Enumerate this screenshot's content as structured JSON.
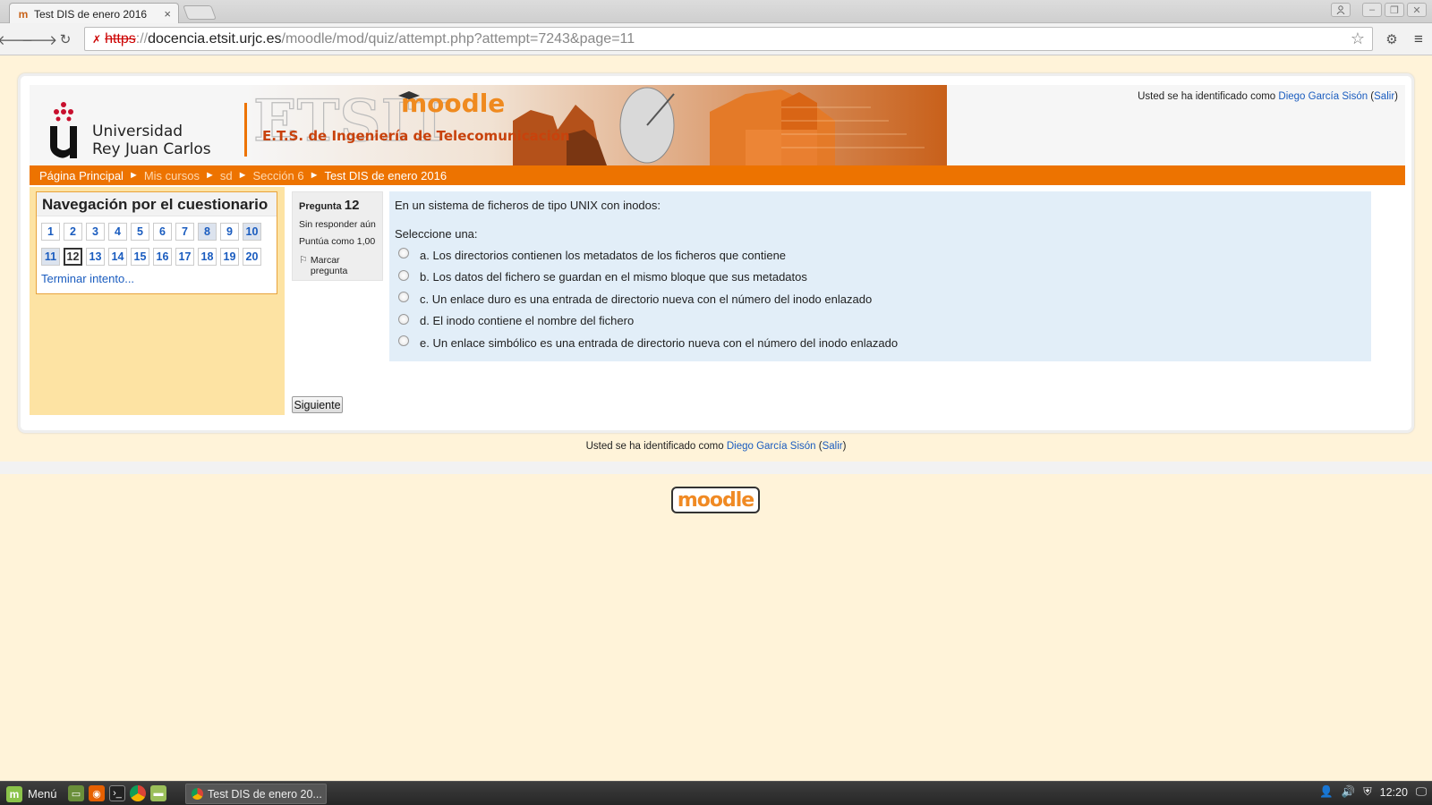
{
  "browser": {
    "tab_title": "Test DIS de enero 2016",
    "tab_close": "×",
    "url_scheme": "https",
    "url_sep": "://",
    "url_host": "docencia.etsit.urjc.es",
    "url_path": "/moodle/mod/quiz/attempt.php?attempt=7243&page=11"
  },
  "header": {
    "university_line1": "Universidad",
    "university_line2": "Rey Juan Carlos",
    "banner_etsit": "ETSIT",
    "banner_moodle": "moodle",
    "banner_school": "E.T.S. de Ingeniería de Telecomunicación",
    "login_prefix": "Usted se ha identificado como",
    "user_name": "Diego García Sisón",
    "logout": "Salir"
  },
  "breadcrumb": [
    "Página Principal",
    "Mis cursos",
    "sd",
    "Sección 6",
    "Test DIS de enero 2016"
  ],
  "quiz_nav": {
    "title": "Navegación por el cuestionario",
    "questions": [
      {
        "n": "1",
        "state": "normal"
      },
      {
        "n": "2",
        "state": "normal"
      },
      {
        "n": "3",
        "state": "normal"
      },
      {
        "n": "4",
        "state": "normal"
      },
      {
        "n": "5",
        "state": "normal"
      },
      {
        "n": "6",
        "state": "normal"
      },
      {
        "n": "7",
        "state": "normal"
      },
      {
        "n": "8",
        "state": "answered"
      },
      {
        "n": "9",
        "state": "normal"
      },
      {
        "n": "10",
        "state": "answered"
      },
      {
        "n": "11",
        "state": "answered"
      },
      {
        "n": "12",
        "state": "current"
      },
      {
        "n": "13",
        "state": "normal"
      },
      {
        "n": "14",
        "state": "normal"
      },
      {
        "n": "15",
        "state": "normal"
      },
      {
        "n": "16",
        "state": "normal"
      },
      {
        "n": "17",
        "state": "normal"
      },
      {
        "n": "18",
        "state": "normal"
      },
      {
        "n": "19",
        "state": "normal"
      },
      {
        "n": "20",
        "state": "normal"
      }
    ],
    "finish_link": "Terminar intento..."
  },
  "question": {
    "label": "Pregunta",
    "number": "12",
    "status": "Sin responder aún",
    "score": "Puntúa como 1,00",
    "flag_line1": "Marcar",
    "flag_line2": "pregunta",
    "text": "En un sistema de ficheros de tipo UNIX con inodos:",
    "prompt": "Seleccione una:",
    "options": [
      "a. Los directorios contienen los metadatos de los ficheros que contiene",
      "b. Los datos del fichero se guardan en el mismo bloque que sus metadatos",
      "c. Un enlace duro es una entrada de directorio nueva con el número del inodo enlazado",
      "d. El inodo contiene el nombre del fichero",
      "e. Un enlace simbólico es una entrada de directorio nueva con el número del inodo enlazado"
    ],
    "next_button": "Siguiente"
  },
  "footer": {
    "login_prefix": "Usted se ha identificado como",
    "user_name": "Diego García Sisón",
    "logout": "Salir",
    "badge": "moodle"
  },
  "taskbar": {
    "menu": "Menú",
    "window_title": "Test DIS de enero 20...",
    "clock": "12:20"
  },
  "colors": {
    "accent_orange": "#ed7300",
    "sidebar_bg": "#fde3a3",
    "question_bg": "#e2eef8",
    "link_blue": "#1a5cbf",
    "page_bg": "#fff3d9"
  }
}
